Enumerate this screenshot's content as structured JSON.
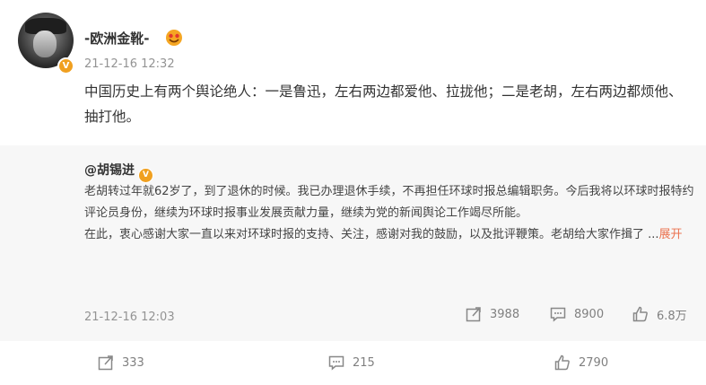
{
  "post": {
    "username": "-欧洲金靴-",
    "timestamp": "21-12-16 12:32",
    "text": "中国历史上有两个舆论绝人：一是鲁迅，左右两边都爱他、拉拢他；二是老胡，左右两边都烦他、抽打他。",
    "verified_icon": "v-badge-icon",
    "user_tag_icon": "emoji-tag-icon"
  },
  "repost": {
    "author": "@胡锡进",
    "paragraph1": "老胡转过年就62岁了，到了退休的时候。我已办理退休手续，不再担任环球时报总编辑职务。今后我将以环球时报特约评论员身份，继续为环球时报事业发展贡献力量，继续为党的新闻舆论工作竭尽所能。",
    "paragraph2": "在此，衷心感谢大家一直以来对环球时报的支持、关注，感谢对我的鼓励，以及批评鞭策。老胡给大家作揖了 ...",
    "expand_label": "展开",
    "timestamp": "21-12-16 12:03",
    "repost_count": "3988",
    "comment_count": "8900",
    "like_count": "6.8万"
  },
  "actions": {
    "repost_count": "333",
    "comment_count": "215",
    "like_count": "2790"
  },
  "colors": {
    "accent_orange": "#eb7350",
    "badge": "#f0a020",
    "muted": "#939393"
  }
}
